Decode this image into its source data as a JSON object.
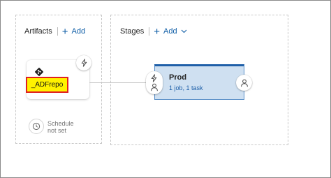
{
  "artifacts": {
    "title": "Artifacts",
    "add_label": "Add",
    "artifact_name": "_ADFrepo",
    "schedule_line1": "Schedule",
    "schedule_line2": "not set"
  },
  "stages": {
    "title": "Stages",
    "add_label": "Add",
    "stage_name": "Prod",
    "stage_meta": "1 job, 1 task"
  },
  "colors": {
    "accent": "#0e5da6",
    "stage_bg": "#cfe0f1",
    "stage_border": "#1f5fa8",
    "highlight_fill": "#fff200",
    "highlight_border": "#e02020"
  },
  "icons": {
    "add": "plus-icon",
    "artifact_source": "git-icon",
    "trigger": "lightning-icon",
    "schedule": "clock-icon",
    "approvals": "person-icon",
    "dropdown": "chevron-down-icon"
  }
}
